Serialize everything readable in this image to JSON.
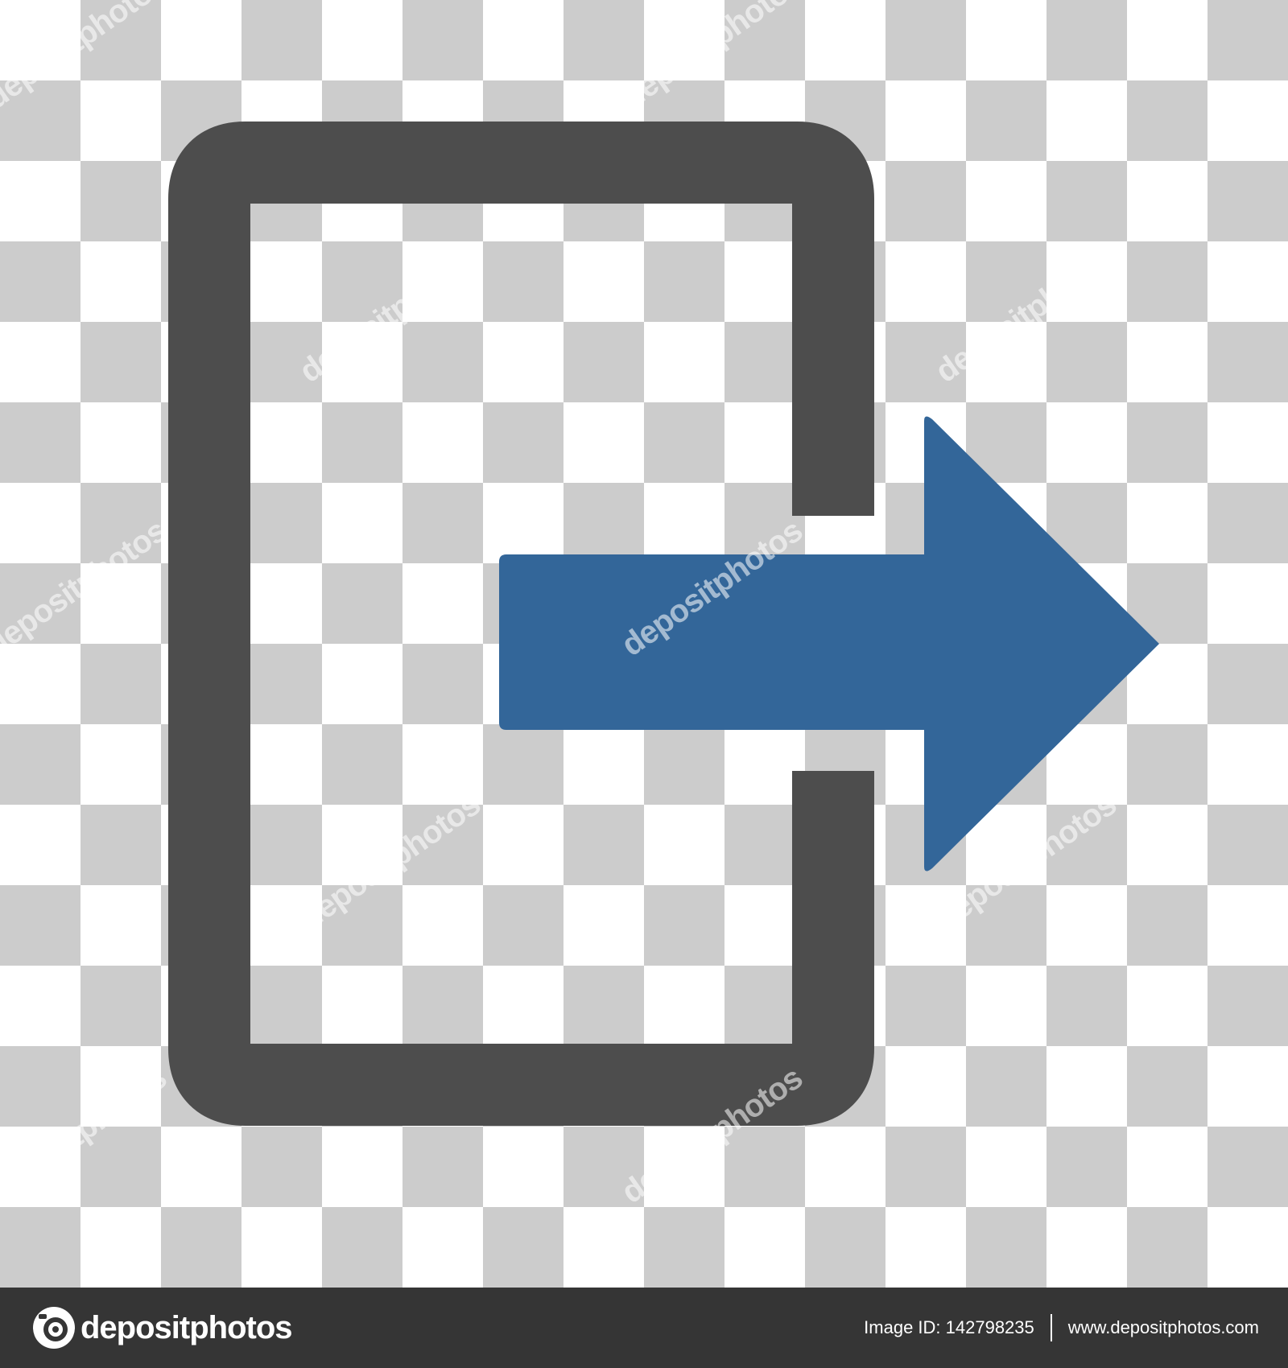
{
  "icon": {
    "name": "exit-door-icon",
    "door_color": "#4d4d4d",
    "arrow_color": "#336699"
  },
  "background": {
    "pattern": "transparency-checkerboard",
    "light_color": "#ffffff",
    "dark_color": "#cccccc"
  },
  "watermark": {
    "text": "depositphotos"
  },
  "footer": {
    "background": "#353535",
    "logo_text": "depositphotos",
    "image_id": "Image ID: 142798235",
    "url": "www.depositphotos.com"
  }
}
